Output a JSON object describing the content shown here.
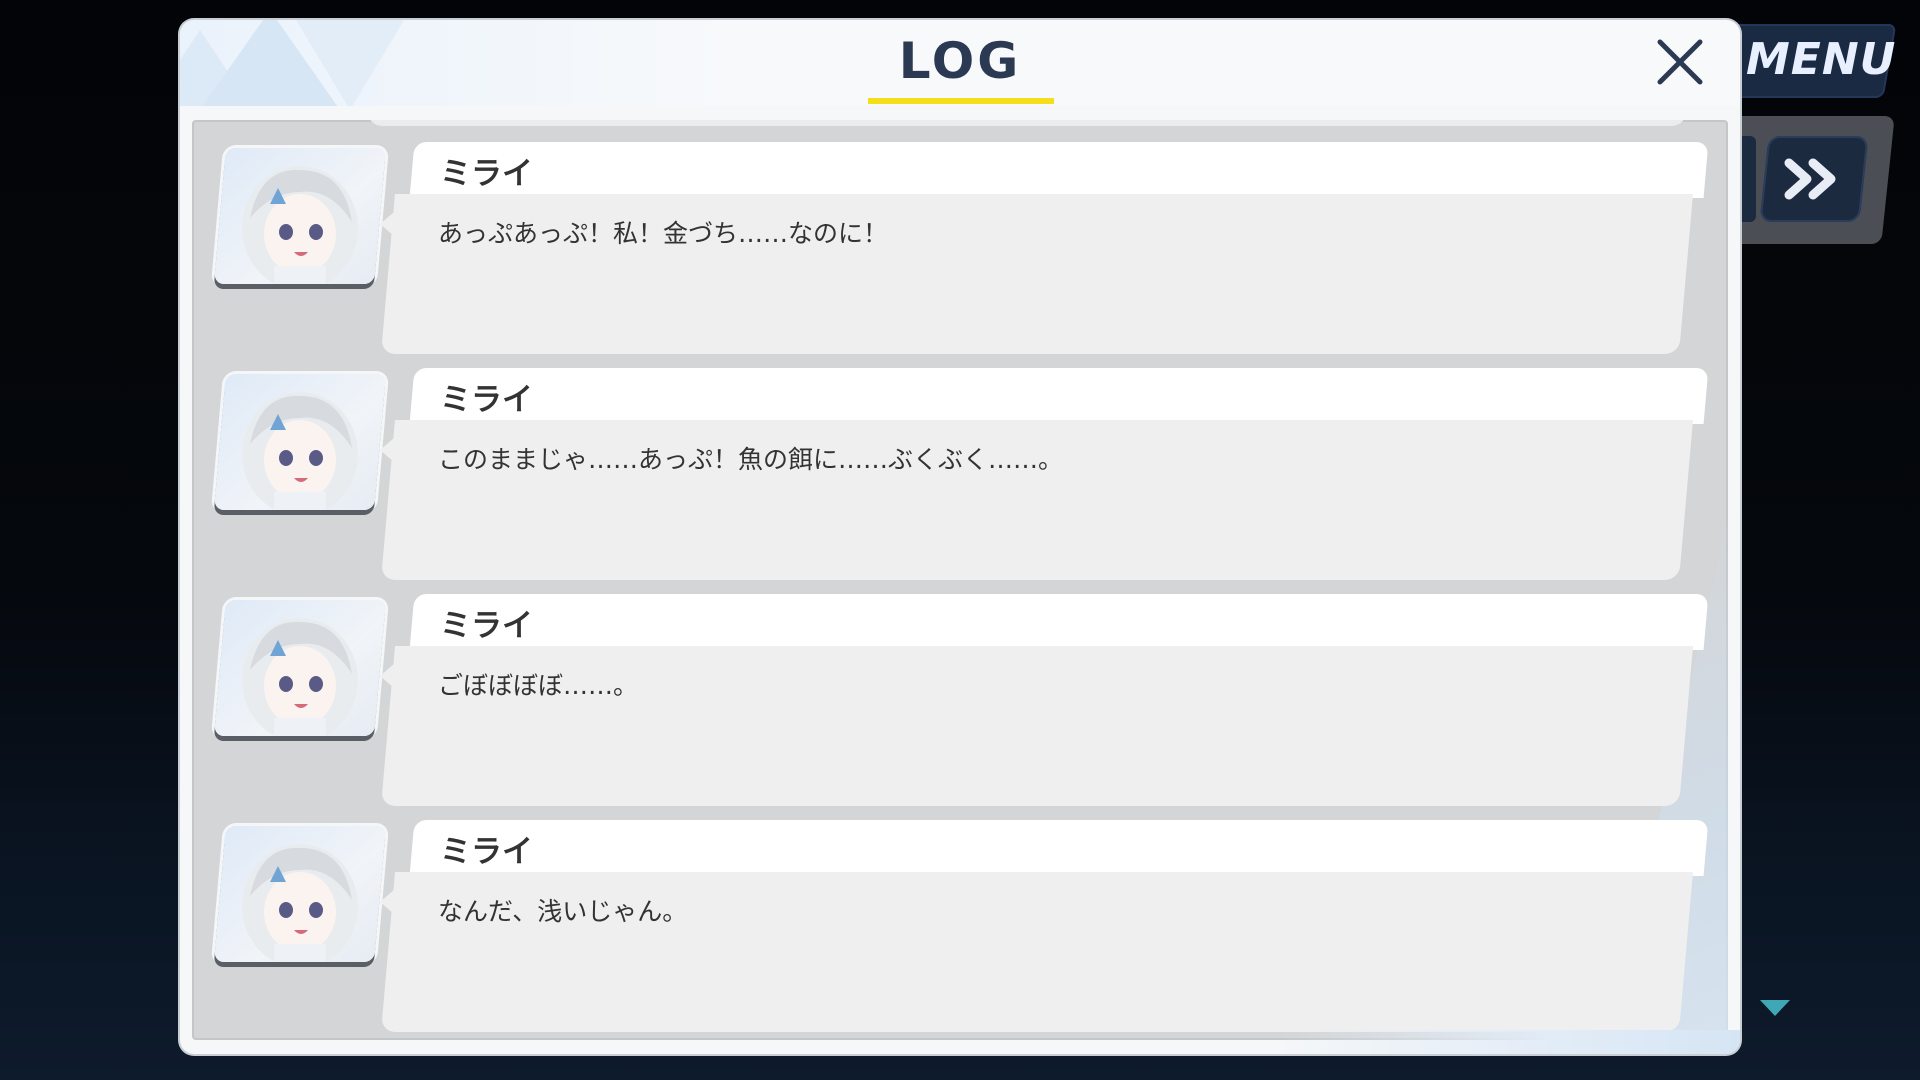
{
  "hud": {
    "menu_label": "MENU",
    "skip_icon": "fast-forward-icon",
    "scroll_icon": "triangle-down-icon"
  },
  "modal": {
    "title": "LOG",
    "close_icon": "close-icon",
    "accent_color": "#f5df1d"
  },
  "log": {
    "entries": [
      {
        "speaker": "ミライ",
        "text": "あっぷあっぷ！私！金づち……なのに！"
      },
      {
        "speaker": "ミライ",
        "text": "このままじゃ……あっぷ！魚の餌に……ぶくぶく……。"
      },
      {
        "speaker": "ミライ",
        "text": "ごぼぼぼぼ……。"
      },
      {
        "speaker": "ミライ",
        "text": "なんだ、浅いじゃん。"
      }
    ]
  }
}
